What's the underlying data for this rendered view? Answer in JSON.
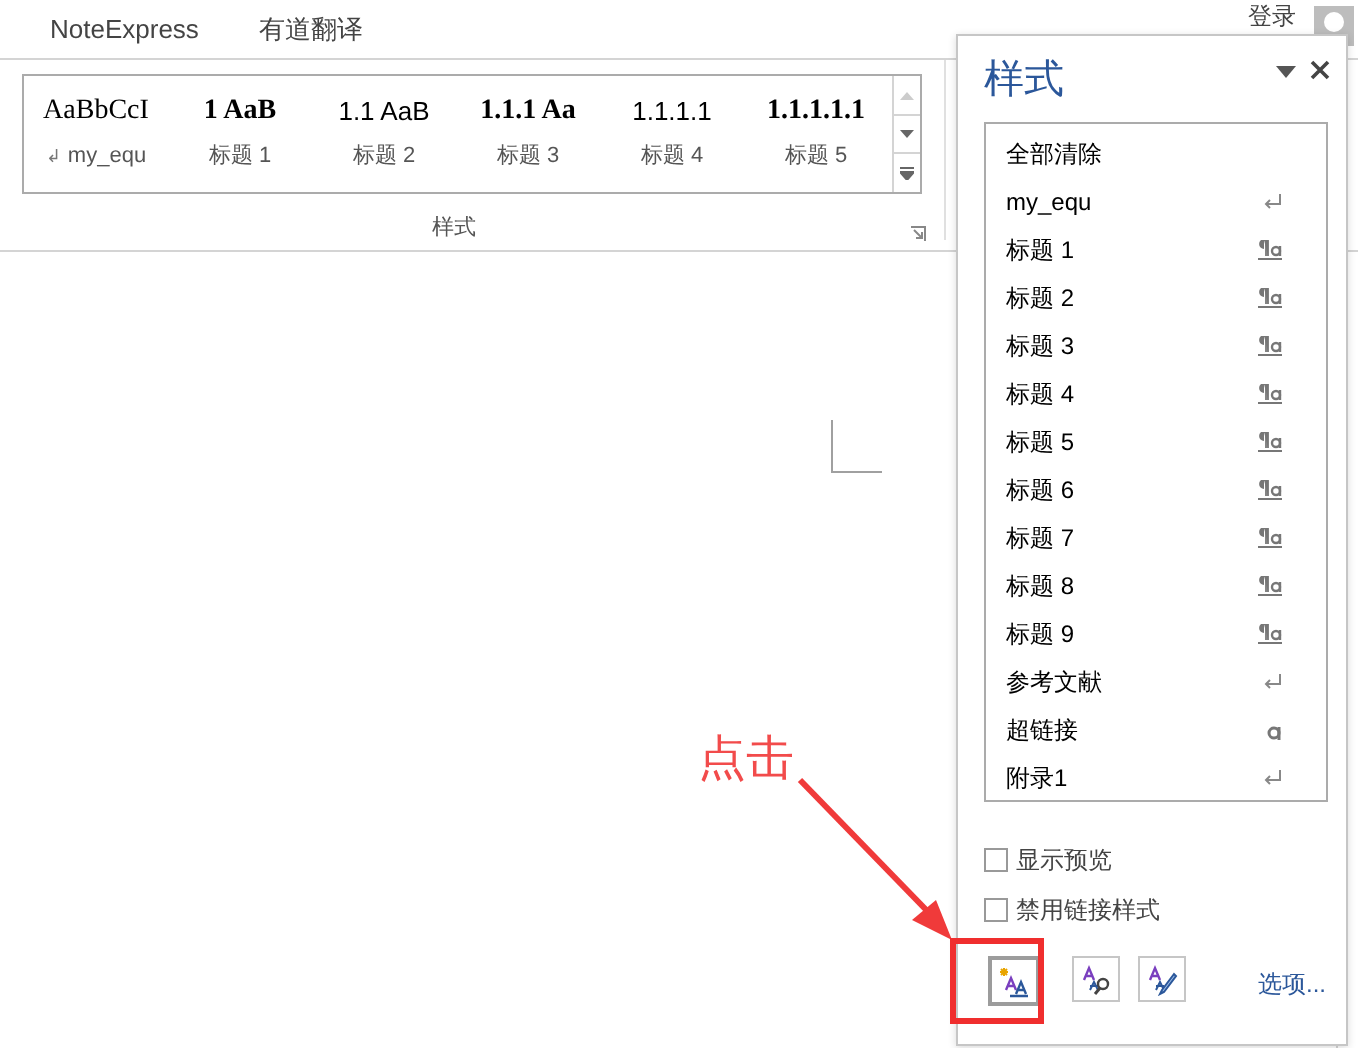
{
  "ribbon_tabs": [
    {
      "label": "NoteExpress"
    },
    {
      "label": "有道翻译"
    }
  ],
  "account": {
    "label": "登录"
  },
  "style_gallery": {
    "items": [
      {
        "preview": "AaBbCcI",
        "label": "my_equ",
        "kind": "serif",
        "para_mark": "↲"
      },
      {
        "preview": "1  AaB",
        "label": "标题 1",
        "kind": "serif-bold"
      },
      {
        "preview": "1.1  AaB",
        "label": "标题 2",
        "kind": "sans"
      },
      {
        "preview": "1.1.1  Aa",
        "label": "标题 3",
        "kind": "serif-bold"
      },
      {
        "preview": "1.1.1.1",
        "label": "标题 4",
        "kind": "sans"
      },
      {
        "preview": "1.1.1.1.1",
        "label": "标题 5",
        "kind": "serif-bold"
      }
    ],
    "group_label": "样式"
  },
  "styles_pane": {
    "title": "样式",
    "items": [
      {
        "name": "全部清除",
        "kind": "none"
      },
      {
        "name": "my_equ",
        "kind": "paragraph"
      },
      {
        "name": "标题 1",
        "kind": "linked"
      },
      {
        "name": "标题 2",
        "kind": "linked"
      },
      {
        "name": "标题 3",
        "kind": "linked"
      },
      {
        "name": "标题 4",
        "kind": "linked"
      },
      {
        "name": "标题 5",
        "kind": "linked"
      },
      {
        "name": "标题 6",
        "kind": "linked"
      },
      {
        "name": "标题 7",
        "kind": "linked"
      },
      {
        "name": "标题 8",
        "kind": "linked"
      },
      {
        "name": "标题 9",
        "kind": "linked"
      },
      {
        "name": "参考文献",
        "kind": "paragraph"
      },
      {
        "name": "超链接",
        "kind": "character"
      },
      {
        "name": "附录1",
        "kind": "paragraph"
      }
    ],
    "checkboxes": [
      {
        "label": "显示预览",
        "checked": false
      },
      {
        "label": "禁用链接样式",
        "checked": false
      }
    ],
    "buttons": [
      {
        "kind": "new-style",
        "selected": true
      },
      {
        "kind": "style-inspector",
        "selected": false
      },
      {
        "kind": "manage-styles",
        "selected": false
      }
    ],
    "options_link": "选项..."
  },
  "annotation": {
    "text": "点击"
  }
}
